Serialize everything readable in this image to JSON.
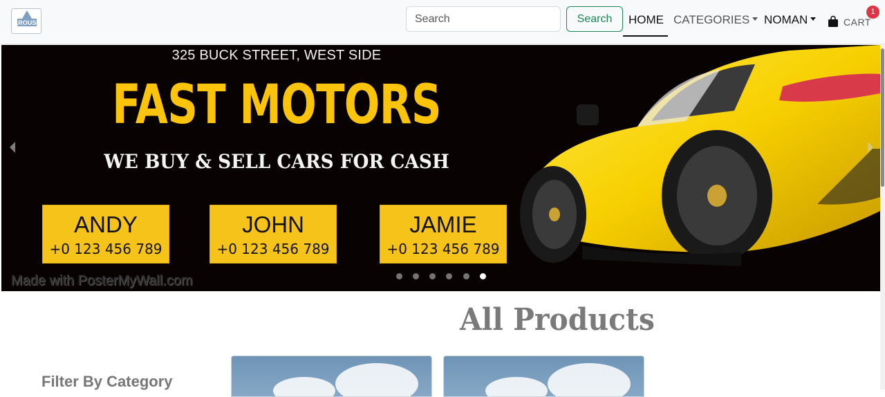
{
  "navbar": {
    "logo_text": "AROUSE",
    "search": {
      "placeholder": "Search",
      "value": ""
    },
    "search_button_label": "Search",
    "links": {
      "home": "HOME",
      "categories": "CATEGORIES",
      "user": "NOMAN"
    },
    "cart": {
      "label": "CART",
      "count": "1"
    }
  },
  "carousel": {
    "address": "325 BUCK STREET, WEST SIDE",
    "title": "FAST MOTORS",
    "subtitle": "WE BUY & SELL CARS FOR CASH",
    "contacts": [
      {
        "name": "ANDY",
        "phone": "+0 123 456 789"
      },
      {
        "name": "JOHN",
        "phone": "+0 123 456 789"
      },
      {
        "name": "JAMIE",
        "phone": "+0 123 456 789"
      }
    ],
    "watermark": "Made with PosterMyWall.com",
    "slide_count": 6,
    "active_slide": 6,
    "accent_color": "#fac40d"
  },
  "content": {
    "page_title": "All Products",
    "filter_heading": "Filter By Category",
    "products_visible": 2
  },
  "icons": {
    "prev": "chevron-left-icon",
    "next": "chevron-right-icon",
    "cart": "shopping-bag-icon",
    "caret": "caret-down-icon"
  },
  "colors": {
    "primary_button": "#198754",
    "badge": "#dc3545",
    "banner_bg": "#080203"
  }
}
